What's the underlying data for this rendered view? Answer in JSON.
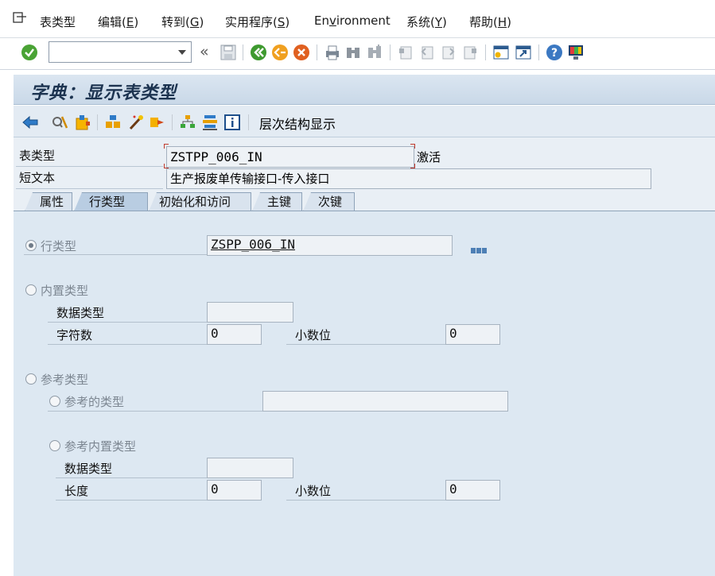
{
  "menu": {
    "items": [
      {
        "label": "表类型",
        "shortcut": ""
      },
      {
        "label": "编辑(",
        "shortcut": "E",
        "suffix": ")"
      },
      {
        "label": "转到(",
        "shortcut": "G",
        "suffix": ")"
      },
      {
        "label": "实用程序(",
        "shortcut": "S",
        "suffix": ")"
      },
      {
        "label": "En",
        "shortcut": "v",
        "suffix": "ironment"
      },
      {
        "label": "系统(",
        "shortcut": "Y",
        "suffix": ")"
      },
      {
        "label": "帮助(",
        "shortcut": "H",
        "suffix": ")"
      }
    ]
  },
  "toolbar": {
    "command_value": "",
    "nav_back_symbol": "«"
  },
  "title": "字典：显示表类型",
  "app_toolbar": {
    "hierarchy_label": "层次结构显示"
  },
  "header": {
    "table_type_label": "表类型",
    "table_type_value": "ZSTPP_006_IN",
    "status": "激活",
    "short_text_label": "短文本",
    "short_text_value": "生产报废单传输接口-传入接口"
  },
  "tabs": [
    {
      "label": "属性",
      "active": false
    },
    {
      "label": "行类型",
      "active": true
    },
    {
      "label": "初始化和访问",
      "active": false
    },
    {
      "label": "主键",
      "active": false
    },
    {
      "label": "次键",
      "active": false
    }
  ],
  "row_type": {
    "radio_row_type": "行类型",
    "row_type_value": "ZSPP_006_IN",
    "radio_builtin": "内置类型",
    "data_type_label": "数据类型",
    "data_type_value": "",
    "chars_label": "字符数",
    "chars_value": "0",
    "decimals_label": "小数位",
    "decimals_value": "0",
    "radio_ref": "参考类型",
    "radio_ref_type": "参考的类型",
    "ref_type_value": "",
    "radio_ref_builtin": "参考内置类型",
    "ref_data_type_label": "数据类型",
    "ref_data_type_value": "",
    "length_label": "长度",
    "length_value": "0",
    "ref_decimals_label": "小数位",
    "ref_decimals_value": "0"
  }
}
